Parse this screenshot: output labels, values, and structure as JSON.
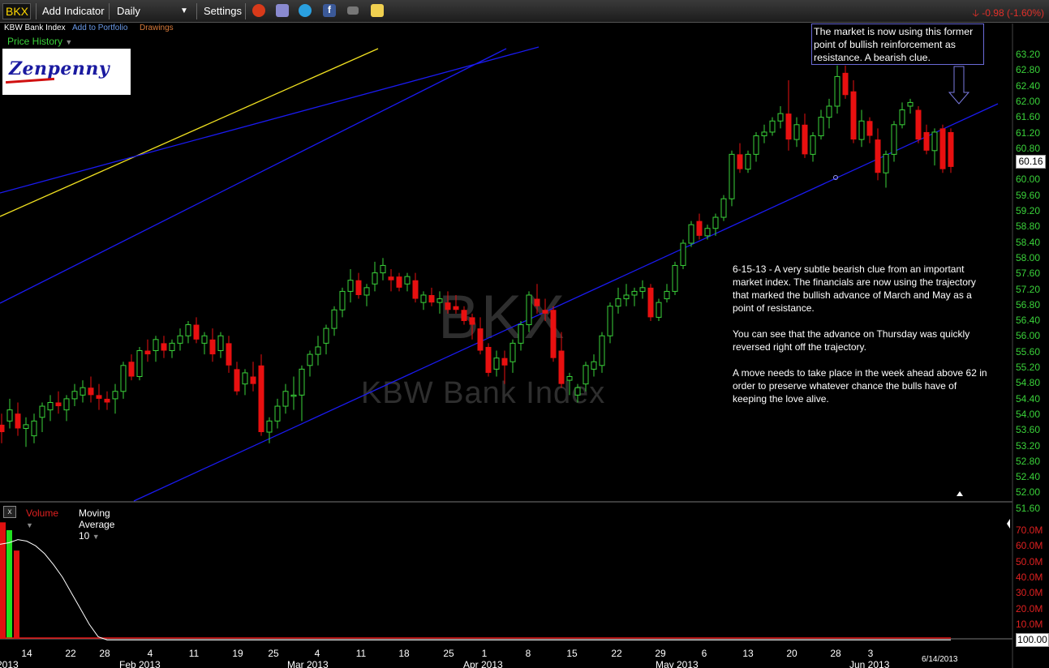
{
  "toolbar": {
    "symbol": "BKX",
    "add_indicator": "Add Indicator",
    "timeframe": "Daily",
    "settings": "Settings",
    "change": "-0.98 (-1.60%)",
    "colors": {
      "symbol": "#ffd800",
      "down": "#e0302a"
    }
  },
  "subbar": {
    "name": "KBW Bank Index",
    "add_to_portfolio": "Add to Portfolio",
    "drawings": "Drawings"
  },
  "price_history_label": "Price History",
  "logo_text": "Zenpenny",
  "watermark": {
    "symbol": "BKX",
    "name": "KBW Bank Index"
  },
  "note_box": "The market is now using this former point of bullish reinforcement as resistance. A bearish clue.",
  "commentary": [
    "6-15-13 - A very subtle bearish clue from an important market index. The financials are now using the trajectory that marked the bullish advance of March and May as a point of resistance.",
    "You can see that the advance on Thursday was quickly reversed right off the trajectory.",
    "A move needs to take place in the week ahead above 62 in order to preserve whatever chance the bulls have of keeping the love alive."
  ],
  "last_price": "60.16",
  "volume_panel": {
    "close": "x",
    "volume_label": "Volume",
    "ma_label": "Moving Average 10",
    "last_value": "100.00",
    "y_ticks": [
      "70.0M",
      "60.0M",
      "50.0M",
      "40.0M",
      "30.0M",
      "20.0M",
      "10.0M"
    ]
  },
  "date_label": "6/14/2013",
  "chart_data": {
    "type": "candlestick",
    "y_ticks": [
      "63.20",
      "62.80",
      "62.40",
      "62.00",
      "61.60",
      "61.20",
      "60.80",
      "60.40",
      "60.00",
      "59.60",
      "59.20",
      "58.80",
      "58.40",
      "58.00",
      "57.60",
      "57.20",
      "56.80",
      "56.40",
      "56.00",
      "55.60",
      "55.20",
      "54.80",
      "54.40",
      "54.00",
      "53.60",
      "53.20",
      "52.80",
      "52.40",
      "52.00",
      "51.60"
    ],
    "ylim": [
      51.2,
      63.6
    ],
    "x_ticks": [
      "14",
      "22",
      "28",
      "4",
      "11",
      "19",
      "25",
      "4",
      "11",
      "18",
      "25",
      "1",
      "8",
      "15",
      "22",
      "29",
      "6",
      "13",
      "20",
      "28",
      "3"
    ],
    "months": [
      "2013",
      "Feb 2013",
      "Mar 2013",
      "Apr 2013",
      "May 2013",
      "Jun 2013"
    ],
    "colors": {
      "up": "#3ad23a",
      "down": "#e81010",
      "trend": "#1a1af0",
      "yellow": "#f0e020",
      "volume_up": "#20e020",
      "volume_down": "#e01010"
    },
    "candles": [
      [
        53.2,
        53.5,
        52.7,
        53.0
      ],
      [
        53.3,
        53.9,
        53.1,
        53.6
      ],
      [
        53.5,
        53.8,
        52.9,
        53.1
      ],
      [
        53.1,
        53.4,
        52.6,
        53.2
      ],
      [
        52.9,
        53.5,
        52.7,
        53.3
      ],
      [
        53.4,
        53.8,
        53.0,
        53.7
      ],
      [
        53.6,
        54.0,
        53.3,
        53.8
      ],
      [
        53.8,
        54.1,
        53.5,
        53.7
      ],
      [
        53.6,
        54.0,
        53.3,
        53.9
      ],
      [
        53.9,
        54.3,
        53.7,
        54.1
      ],
      [
        54.0,
        54.4,
        53.8,
        54.2
      ],
      [
        54.2,
        54.5,
        53.8,
        54.0
      ],
      [
        54.0,
        54.3,
        53.6,
        53.9
      ],
      [
        53.9,
        54.1,
        53.6,
        53.8
      ],
      [
        53.9,
        54.3,
        53.5,
        54.1
      ],
      [
        54.1,
        54.9,
        53.9,
        54.8
      ],
      [
        54.9,
        55.1,
        54.4,
        54.5
      ],
      [
        54.5,
        55.3,
        54.4,
        55.2
      ],
      [
        55.2,
        55.5,
        54.9,
        55.1
      ],
      [
        55.2,
        55.6,
        54.9,
        55.5
      ],
      [
        55.4,
        55.6,
        55.0,
        55.2
      ],
      [
        55.2,
        55.5,
        55.0,
        55.4
      ],
      [
        55.4,
        55.8,
        55.2,
        55.6
      ],
      [
        55.6,
        56.0,
        55.4,
        55.9
      ],
      [
        55.9,
        56.1,
        55.4,
        55.5
      ],
      [
        55.4,
        55.7,
        55.1,
        55.6
      ],
      [
        55.5,
        55.8,
        54.9,
        55.1
      ],
      [
        55.2,
        55.7,
        55.0,
        55.6
      ],
      [
        55.4,
        55.6,
        54.6,
        54.8
      ],
      [
        54.7,
        54.9,
        54.0,
        54.1
      ],
      [
        54.3,
        54.7,
        54.0,
        54.6
      ],
      [
        54.5,
        54.9,
        54.1,
        54.3
      ],
      [
        54.8,
        55.1,
        52.9,
        53.0
      ],
      [
        53.0,
        53.4,
        52.7,
        53.3
      ],
      [
        53.3,
        53.9,
        53.1,
        53.7
      ],
      [
        53.7,
        54.3,
        53.5,
        54.1
      ],
      [
        54.0,
        54.5,
        53.6,
        54.0
      ],
      [
        54.0,
        54.8,
        53.3,
        54.7
      ],
      [
        54.8,
        55.2,
        54.5,
        55.1
      ],
      [
        55.1,
        55.6,
        54.8,
        55.3
      ],
      [
        55.4,
        55.9,
        55.1,
        55.8
      ],
      [
        55.8,
        56.4,
        55.6,
        56.3
      ],
      [
        56.3,
        56.9,
        56.1,
        56.8
      ],
      [
        56.8,
        57.4,
        56.5,
        57.1
      ],
      [
        57.1,
        57.3,
        56.6,
        56.7
      ],
      [
        56.7,
        57.0,
        56.4,
        56.9
      ],
      [
        57.0,
        57.6,
        56.8,
        57.3
      ],
      [
        57.3,
        57.7,
        57.1,
        57.5
      ],
      [
        57.2,
        57.4,
        56.8,
        57.1
      ],
      [
        57.2,
        57.3,
        56.8,
        56.9
      ],
      [
        57.0,
        57.3,
        56.8,
        57.2
      ],
      [
        57.1,
        57.3,
        56.5,
        56.6
      ],
      [
        56.5,
        56.8,
        56.3,
        56.7
      ],
      [
        56.7,
        56.9,
        56.4,
        56.5
      ],
      [
        56.5,
        56.8,
        56.2,
        56.6
      ],
      [
        56.5,
        56.8,
        56.2,
        56.3
      ],
      [
        56.4,
        56.7,
        56.2,
        56.3
      ],
      [
        56.3,
        56.4,
        55.9,
        56.0
      ],
      [
        56.1,
        56.2,
        55.5,
        55.9
      ],
      [
        55.8,
        56.1,
        55.1,
        55.2
      ],
      [
        55.3,
        55.4,
        54.5,
        54.6
      ],
      [
        54.7,
        55.2,
        54.5,
        55.0
      ],
      [
        55.0,
        55.2,
        54.3,
        54.8
      ],
      [
        54.9,
        55.5,
        54.6,
        55.4
      ],
      [
        55.4,
        56.0,
        55.2,
        55.9
      ],
      [
        55.9,
        56.8,
        55.7,
        56.7
      ],
      [
        56.6,
        57.0,
        56.2,
        56.4
      ],
      [
        56.3,
        56.6,
        56.0,
        56.2
      ],
      [
        56.3,
        56.4,
        54.9,
        55.0
      ],
      [
        55.2,
        55.7,
        54.2,
        54.3
      ],
      [
        54.4,
        54.6,
        54.0,
        54.5
      ],
      [
        54.0,
        54.3,
        53.8,
        54.2
      ],
      [
        54.3,
        54.9,
        54.1,
        54.8
      ],
      [
        54.7,
        55.1,
        54.5,
        54.9
      ],
      [
        54.8,
        55.7,
        54.6,
        55.6
      ],
      [
        55.6,
        56.5,
        55.4,
        56.4
      ],
      [
        56.4,
        56.9,
        56.2,
        56.6
      ],
      [
        56.6,
        57.0,
        56.4,
        56.7
      ],
      [
        56.7,
        56.9,
        56.4,
        56.8
      ],
      [
        56.8,
        57.1,
        56.6,
        56.9
      ],
      [
        56.9,
        57.0,
        56.0,
        56.1
      ],
      [
        56.1,
        56.6,
        56.0,
        56.5
      ],
      [
        56.6,
        57.0,
        56.5,
        56.8
      ],
      [
        56.8,
        57.6,
        56.7,
        57.5
      ],
      [
        57.5,
        58.2,
        57.4,
        58.1
      ],
      [
        58.1,
        58.7,
        58.0,
        58.6
      ],
      [
        58.7,
        58.9,
        58.2,
        58.3
      ],
      [
        58.3,
        58.6,
        58.2,
        58.5
      ],
      [
        58.5,
        58.9,
        58.3,
        58.8
      ],
      [
        58.8,
        59.4,
        58.7,
        59.3
      ],
      [
        59.3,
        60.6,
        59.1,
        60.5
      ],
      [
        60.5,
        60.8,
        60.0,
        60.1
      ],
      [
        60.1,
        60.6,
        60.0,
        60.5
      ],
      [
        60.5,
        61.1,
        60.3,
        61.0
      ],
      [
        61.0,
        61.3,
        60.8,
        61.1
      ],
      [
        61.1,
        61.5,
        61.0,
        61.4
      ],
      [
        61.4,
        61.8,
        61.2,
        61.6
      ],
      [
        61.6,
        62.5,
        60.6,
        60.9
      ],
      [
        60.9,
        61.5,
        60.7,
        61.3
      ],
      [
        61.3,
        61.6,
        60.4,
        60.5
      ],
      [
        60.5,
        61.1,
        60.3,
        61.0
      ],
      [
        61.0,
        61.7,
        60.9,
        61.5
      ],
      [
        61.5,
        62.0,
        61.2,
        61.8
      ],
      [
        61.8,
        62.9,
        61.6,
        62.6
      ],
      [
        62.7,
        62.9,
        62.0,
        62.1
      ],
      [
        62.2,
        62.5,
        60.8,
        60.9
      ],
      [
        60.9,
        61.7,
        60.7,
        61.4
      ],
      [
        61.4,
        61.5,
        60.8,
        61.0
      ],
      [
        60.9,
        61.2,
        59.8,
        60.0
      ],
      [
        60.0,
        60.6,
        59.6,
        60.5
      ],
      [
        60.5,
        61.4,
        60.3,
        61.3
      ],
      [
        61.3,
        61.9,
        61.2,
        61.7
      ],
      [
        61.8,
        62.0,
        61.6,
        61.9
      ],
      [
        61.7,
        61.8,
        60.8,
        60.9
      ],
      [
        61.1,
        61.3,
        60.5,
        60.6
      ],
      [
        60.6,
        61.2,
        60.2,
        61.1
      ],
      [
        61.2,
        61.3,
        60.0,
        60.1
      ],
      [
        61.1,
        61.2,
        60.0,
        60.16
      ]
    ],
    "volume": [
      [
        75,
        "down"
      ],
      [
        70,
        "up"
      ],
      [
        57,
        "down"
      ]
    ],
    "volume_ylim": [
      0,
      75
    ],
    "ma_values": [
      61,
      62,
      64,
      63,
      60,
      55,
      48,
      40,
      30,
      20,
      10,
      2,
      0
    ]
  }
}
